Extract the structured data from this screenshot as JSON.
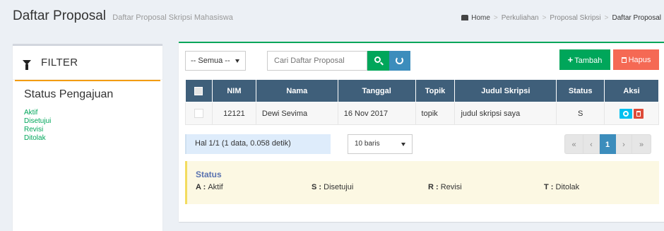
{
  "header": {
    "title": "Daftar Proposal",
    "subtitle": "Daftar Proposal Skripsi Mahasiswa",
    "breadcrumb": [
      "Home",
      "Perkuliahan",
      "Proposal Skripsi",
      "Daftar Proposal"
    ]
  },
  "filter": {
    "title": "FILTER",
    "status_title": "Status Pengajuan",
    "items": [
      "Aktif",
      "Disetujui",
      "Revisi",
      "Ditolak"
    ]
  },
  "toolbar": {
    "select_value": "-- Semua --",
    "search_placeholder": "Cari Daftar Proposal",
    "add_label": "Tambah",
    "delete_label": "Hapus"
  },
  "table": {
    "columns": [
      "NIM",
      "Nama",
      "Tanggal",
      "Topik",
      "Judul Skripsi",
      "Status",
      "Aksi"
    ],
    "rows": [
      {
        "nim": "12121",
        "nama": "Dewi Sevima",
        "tanggal": "16 Nov 2017",
        "topik": "topik",
        "judul": "judul skripsi saya",
        "status": "S"
      }
    ]
  },
  "pagination": {
    "info": "Hal 1/1 (1 data, 0.058 detik)",
    "rows_per_page": "10 baris",
    "current_page": "1",
    "first": "«",
    "prev": "‹",
    "next": "›",
    "last": "»"
  },
  "legend": {
    "title": "Status",
    "items": [
      {
        "code": "A",
        "label": "Aktif"
      },
      {
        "code": "S",
        "label": "Disetujui"
      },
      {
        "code": "R",
        "label": "Revisi"
      },
      {
        "code": "T",
        "label": "Ditolak"
      }
    ]
  },
  "colors": {
    "success": "#00a65a",
    "danger": "#f56954",
    "primary": "#3c8dbc",
    "table_header": "#3f5f7a",
    "info": "#00c0ef"
  }
}
